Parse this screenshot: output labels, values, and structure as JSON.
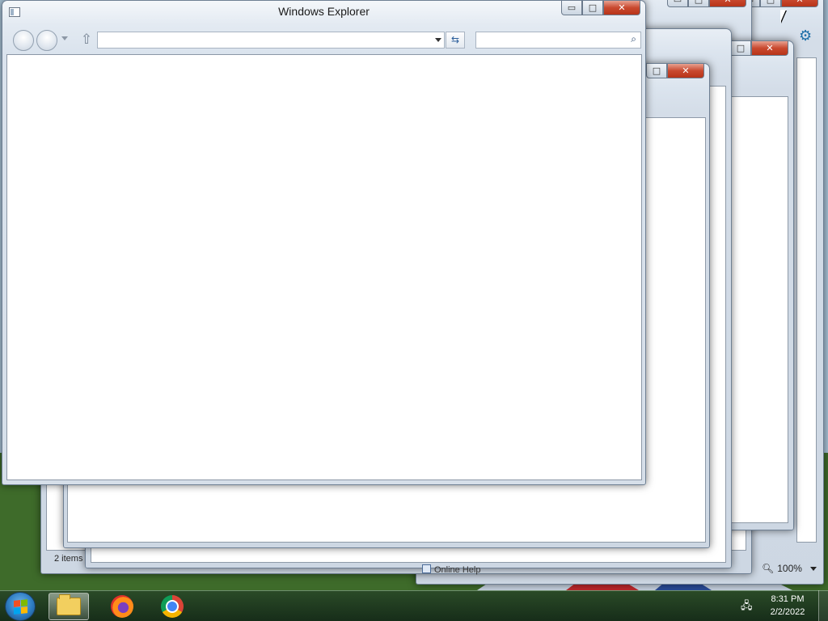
{
  "front_window": {
    "title": "Windows Explorer",
    "address_value": "",
    "search_value": "",
    "minimize_glyph": "▭",
    "maximize_glyph": "□",
    "close_glyph": "✕",
    "refresh_glyph": "⇆",
    "up_glyph": "⇧",
    "search_glyph": "⌕"
  },
  "back_windows": {
    "status_items": "2 items",
    "help_label": "Online Help",
    "zoom_label": "100%"
  },
  "taskbar": {
    "pinned": [
      {
        "name": "Windows Explorer",
        "icon": "folder-icon",
        "active": true
      },
      {
        "name": "Firefox",
        "icon": "firefox-icon",
        "active": false
      },
      {
        "name": "Google Chrome",
        "icon": "chrome-icon",
        "active": false
      }
    ],
    "clock_time": "8:31 PM",
    "clock_date": "2/2/2022"
  },
  "colors": {
    "close_button": "#c9492f",
    "window_frame": "#dae3ed",
    "taskbar": "#1f3a24"
  }
}
